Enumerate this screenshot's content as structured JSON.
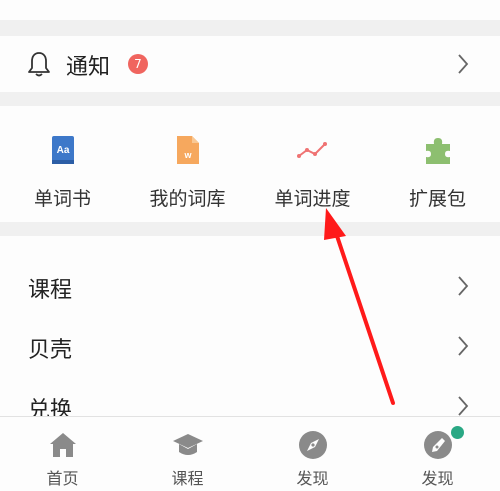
{
  "notification": {
    "label": "通知",
    "badge": "7"
  },
  "grid": [
    {
      "label": "单词书",
      "icon": "book-aa-icon"
    },
    {
      "label": "我的词库",
      "icon": "word-file-icon"
    },
    {
      "label": "单词进度",
      "icon": "trend-line-icon"
    },
    {
      "label": "扩展包",
      "icon": "puzzle-icon"
    }
  ],
  "list": [
    {
      "label": "课程"
    },
    {
      "label": "贝壳"
    },
    {
      "label": "兑换"
    }
  ],
  "tabs": [
    {
      "label": "首页",
      "icon": "home-icon"
    },
    {
      "label": "课程",
      "icon": "graduation-cap-icon"
    },
    {
      "label": "发现",
      "icon": "compass-icon"
    },
    {
      "label": "发现",
      "icon": "pen-nib-icon"
    }
  ],
  "colors": {
    "badge": "#f0655f",
    "book": "#3d78c9",
    "word_file": "#f6a85e",
    "trend": "#ef7373",
    "puzzle": "#8dbf70",
    "tab_icon": "#8a8a8a",
    "tab_dot": "#2aa884",
    "annotation_arrow": "#ff1a1a"
  }
}
